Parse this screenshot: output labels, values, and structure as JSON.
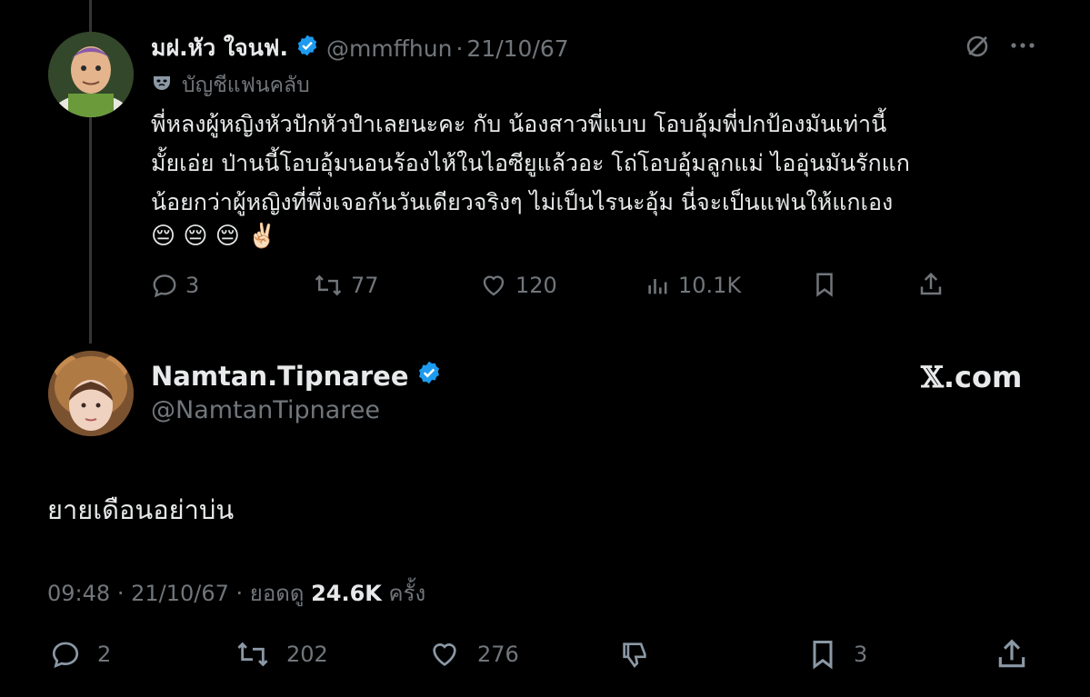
{
  "reply_tweet": {
    "display_name": "มฝ.หัว ใจนฟ.",
    "handle": "@mmffhun",
    "date": "21/10/67",
    "separator": "·",
    "account_label": "บัญชีแฟนคลับ",
    "lines": [
      "พี่หลงผู้หญิงหัวปักหัวปำเลยนะคะ กับ น้องสาวพี่แบบ โอบอุ้มพี่ปกป้องมันเท่านี้",
      "มั้ยเอ่ย ป่านนี้โอบอุ้มนอนร้องไห้ในไอซียูแล้วอะ โถ่โอบอุ้มลูกแม่ ไออุ่นมันรักแก",
      "น้อยกว่าผู้หญิงที่พึ่งเจอกันวันเดียวจริงๆ ไม่เป็นไรนะอุ้ม นี่จะเป็นแฟนให้แกเอง"
    ],
    "emojis": [
      "😔",
      "😔",
      "😔",
      "✌🏻"
    ],
    "stats": {
      "replies": "3",
      "reposts": "77",
      "likes": "120",
      "views": "10.1K"
    }
  },
  "main_tweet": {
    "display_name": "Namtan.Tipnaree",
    "handle": "@NamtanTipnaree",
    "text": "ยายเดือนอย่าบ่น",
    "time": "09:48",
    "date": "21/10/67",
    "views_label": "ยอดดู",
    "views": "24.6K",
    "views_unit": "ครั้ง",
    "stats": {
      "replies": "2",
      "reposts": "202",
      "likes": "276",
      "bookmarks": "3"
    }
  },
  "watermark": {
    "x": "𝕏",
    "domain": ".com"
  },
  "colors": {
    "background": "#000000",
    "text": "#e7e9ea",
    "muted": "#71767b",
    "verified": "#1d9bf0"
  },
  "icons": [
    "grok-icon",
    "more-icon",
    "reply-icon",
    "repost-icon",
    "like-icon",
    "views-icon",
    "bookmark-icon",
    "share-icon",
    "dislike-icon",
    "verified-badge-icon",
    "fanclub-mask-icon"
  ]
}
